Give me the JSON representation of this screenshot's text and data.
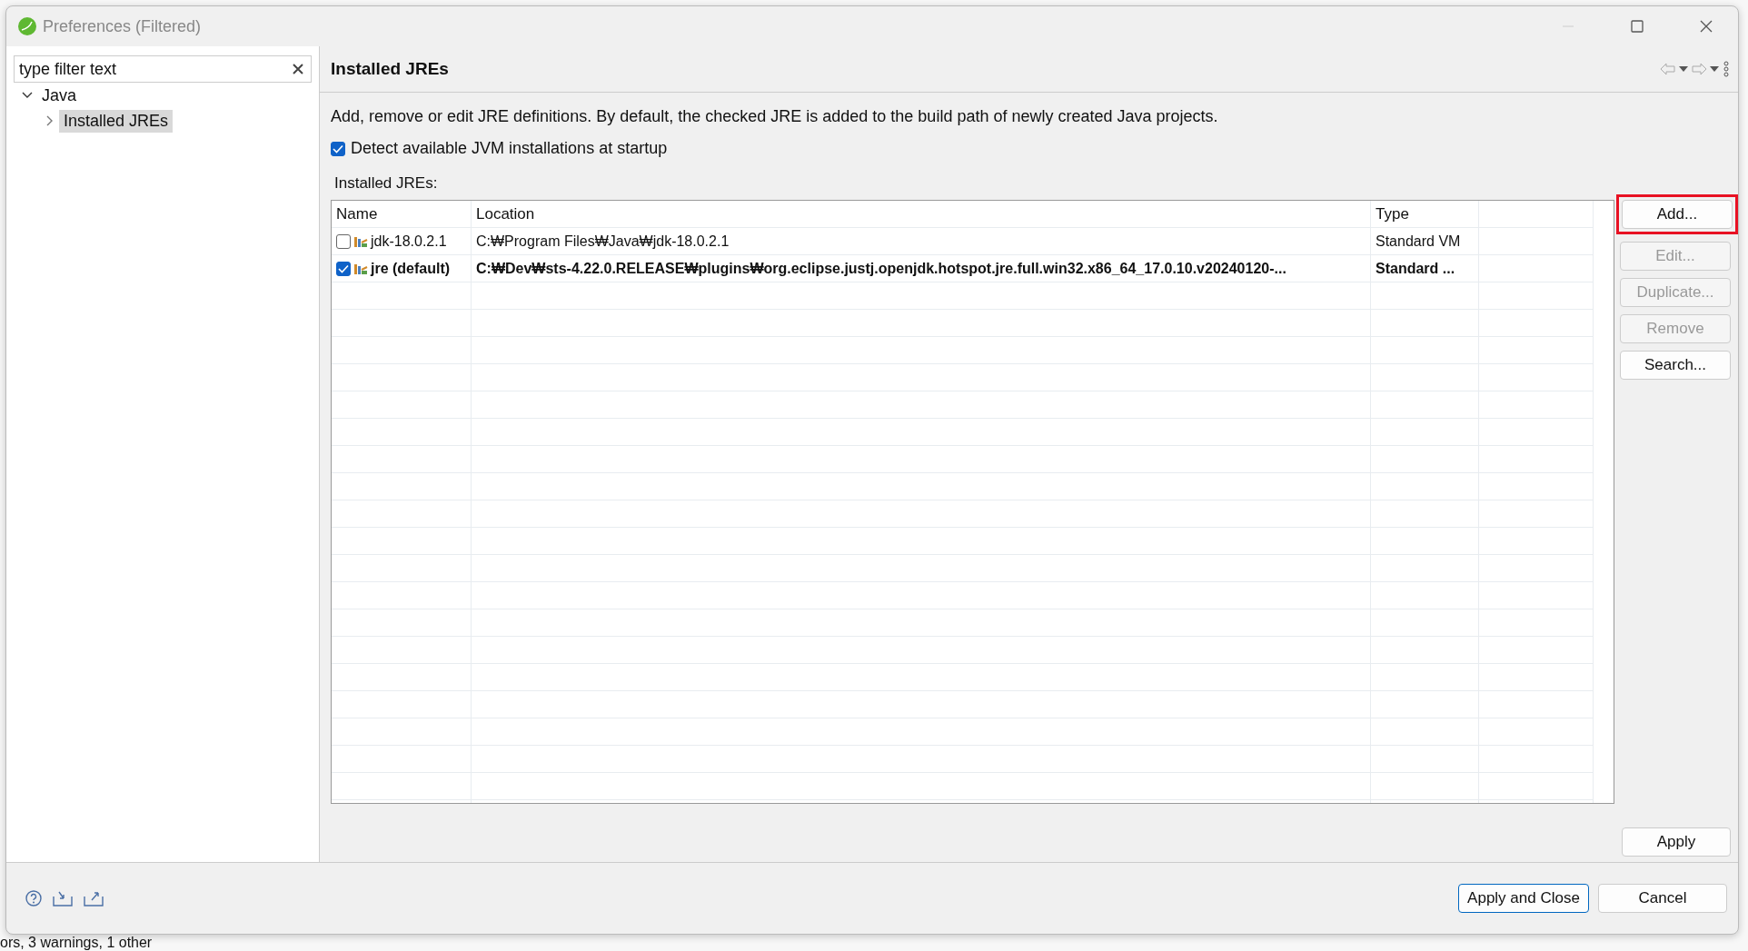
{
  "window": {
    "title": "Preferences (Filtered)"
  },
  "filter": {
    "placeholder": "type filter text"
  },
  "tree": [
    {
      "label": "Java",
      "expanded": true,
      "selected": false,
      "children": [
        {
          "label": "Installed JREs",
          "expanded": false,
          "selected": true
        }
      ]
    }
  ],
  "page": {
    "title": "Installed JREs",
    "description": "Add, remove or edit JRE definitions. By default, the checked JRE is added to the build path of newly created Java projects.",
    "detect_checkbox": {
      "label": "Detect available JVM installations at startup",
      "checked": true
    },
    "table_label": "Installed JREs:",
    "table": {
      "columns": [
        "Name",
        "Location",
        "Type"
      ],
      "rows": [
        {
          "name": "jdk-18.0.2.1",
          "location": "C:₩Program Files₩Java₩jdk-18.0.2.1",
          "type": "Standard VM",
          "checked": false,
          "default": false
        },
        {
          "name": "jre (default)",
          "location": "C:₩Dev₩sts-4.22.0.RELEASE₩plugins₩org.eclipse.justj.openjdk.hotspot.jre.full.win32.x86_64_17.0.10.v20240120-...",
          "type": "Standard ...",
          "checked": true,
          "default": true
        }
      ]
    },
    "buttons": [
      {
        "label": "Add...",
        "disabled": false,
        "highlighted": true
      },
      {
        "label": "Edit...",
        "disabled": true,
        "highlighted": false
      },
      {
        "label": "Duplicate...",
        "disabled": true,
        "highlighted": false
      },
      {
        "label": "Remove",
        "disabled": true,
        "highlighted": false
      },
      {
        "label": "Search...",
        "disabled": false,
        "highlighted": false
      }
    ],
    "apply_button": "Apply"
  },
  "footer": {
    "buttons": [
      {
        "label": "Apply and Close",
        "default": true
      },
      {
        "label": "Cancel",
        "default": false
      }
    ]
  },
  "background_status": "ors, 3 warnings, 1 other"
}
